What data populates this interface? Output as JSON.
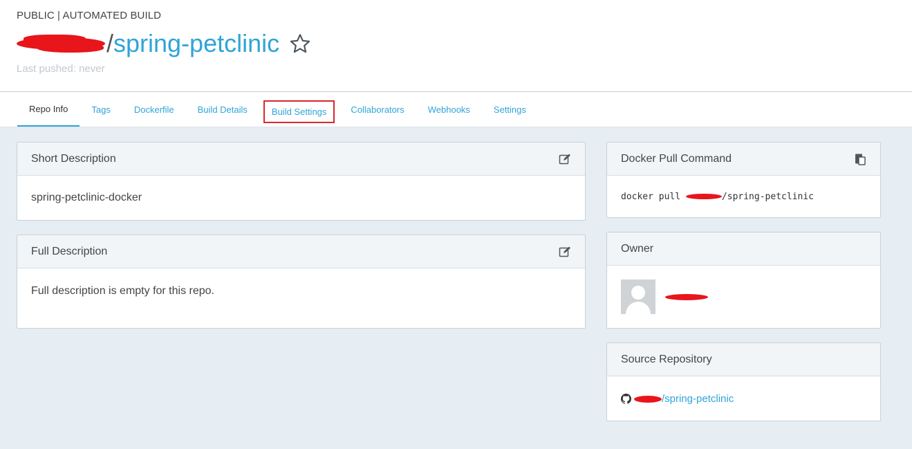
{
  "header": {
    "repo_type": "PUBLIC | AUTOMATED BUILD",
    "slash": "/",
    "repo_name": "spring-petclinic",
    "last_pushed": "Last pushed: never"
  },
  "tabs": [
    {
      "label": "Repo Info"
    },
    {
      "label": "Tags"
    },
    {
      "label": "Dockerfile"
    },
    {
      "label": "Build Details"
    },
    {
      "label": "Build Settings"
    },
    {
      "label": "Collaborators"
    },
    {
      "label": "Webhooks"
    },
    {
      "label": "Settings"
    }
  ],
  "short_description": {
    "title": "Short Description",
    "value": "spring-petclinic-docker",
    "icon": "edit-icon"
  },
  "full_description": {
    "title": "Full Description",
    "value": "Full description is empty for this repo.",
    "icon": "edit-icon"
  },
  "pull_command": {
    "title": "Docker Pull Command",
    "prefix": "docker pull ",
    "suffix": "/spring-petclinic",
    "icon": "clipboard-icon"
  },
  "owner": {
    "title": "Owner",
    "icon": "avatar-placeholder"
  },
  "source_repo": {
    "title": "Source Repository",
    "suffix": "/spring-petclinic",
    "icon": "github-icon"
  },
  "colors": {
    "accent": "#2fa4d7",
    "background": "#e6edf3",
    "redaction": "#e8151b",
    "highlight_box": "#d9262d"
  }
}
